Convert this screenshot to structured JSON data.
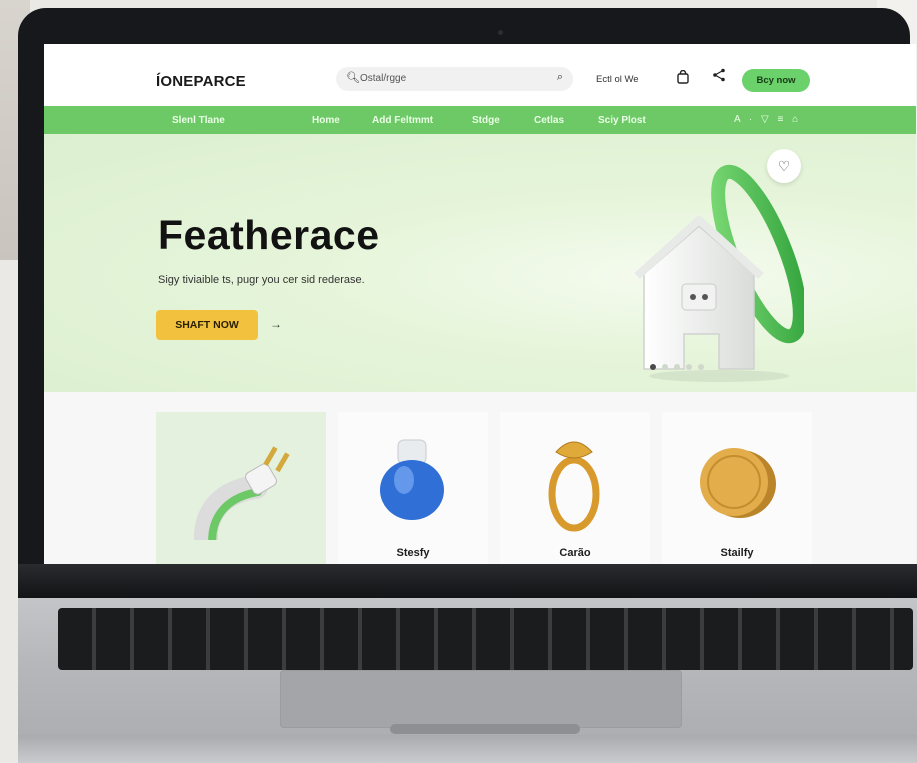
{
  "site": {
    "logo": "ÍONEPARCE",
    "search_placeholder": "Ostal/rgge",
    "account_label": "Ectl ol We",
    "buy_button": "Bcy now"
  },
  "nav": {
    "items": [
      "Slenl Tlane",
      "Home",
      "Add Feltmmt",
      "Stdge",
      "Cetlas",
      "Sciy Plost"
    ],
    "icon_text": "A · ▽ ≡ ⌂"
  },
  "hero": {
    "title": "Featherace",
    "subtitle": "Sigy tiviaible ts, pugr you cer sid rederase.",
    "cta": "SHAFT NOW",
    "cta_arrow": "→",
    "slide_count": 5,
    "active_slide": 1
  },
  "products": [
    {
      "label": "",
      "icon": "plug-icon"
    },
    {
      "label": "Stesfy",
      "icon": "blue-bottle-icon"
    },
    {
      "label": "Carão",
      "icon": "ring-icon"
    },
    {
      "label": "Stailfy",
      "icon": "coin-icon"
    }
  ],
  "colors": {
    "accent_green": "#6cc966",
    "cta_yellow": "#f2c23f",
    "hero_bg": "#dcefd0"
  }
}
